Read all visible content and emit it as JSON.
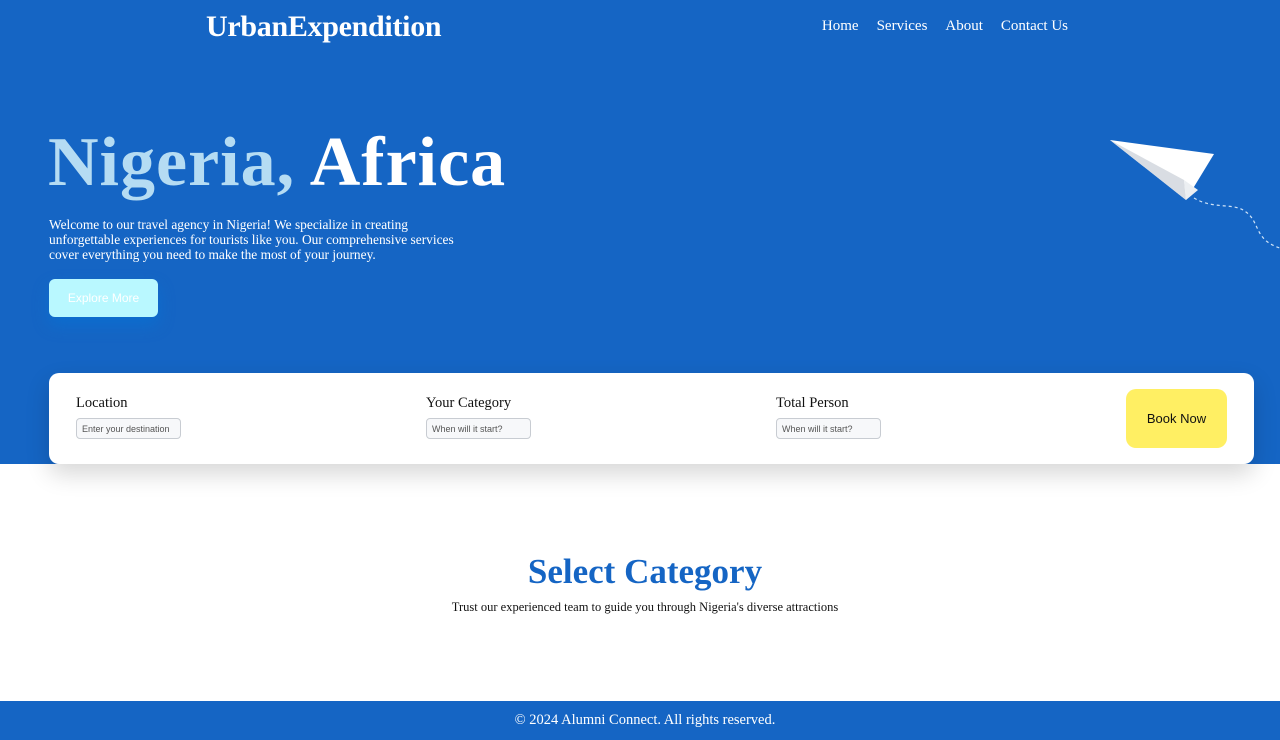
{
  "header": {
    "brand": "UrbanExpendition",
    "nav": [
      "Home",
      "Services",
      "About",
      "Contact Us"
    ]
  },
  "hero": {
    "title_part1": "Nigeria,",
    "title_part2": "Africa",
    "intro": "Welcome to our travel agency in Nigeria! We specialize in creating unforgettable experiences for tourists like you. Our comprehensive services cover everything you need to make the most of your journey.",
    "cta_label": "Explore More",
    "decoration_icon": "paper-plane-icon"
  },
  "booking": {
    "fields": [
      {
        "label": "Location",
        "placeholder": "Enter your destination"
      },
      {
        "label": "Your Category",
        "placeholder": "When will it start?"
      },
      {
        "label": "Total Person",
        "placeholder": "When will it start?"
      }
    ],
    "submit_label": "Book Now"
  },
  "category": {
    "title": "Select Category",
    "subtitle": "Trust our experienced team to guide you through Nigeria's diverse attractions"
  },
  "footer": {
    "text": "© 2024 Alumni Connect. All rights reserved."
  },
  "colors": {
    "primary": "#1565c4",
    "accent_light": "#b5dcf3",
    "cta": "#b9f8ff",
    "book_button": "#ffef63"
  }
}
